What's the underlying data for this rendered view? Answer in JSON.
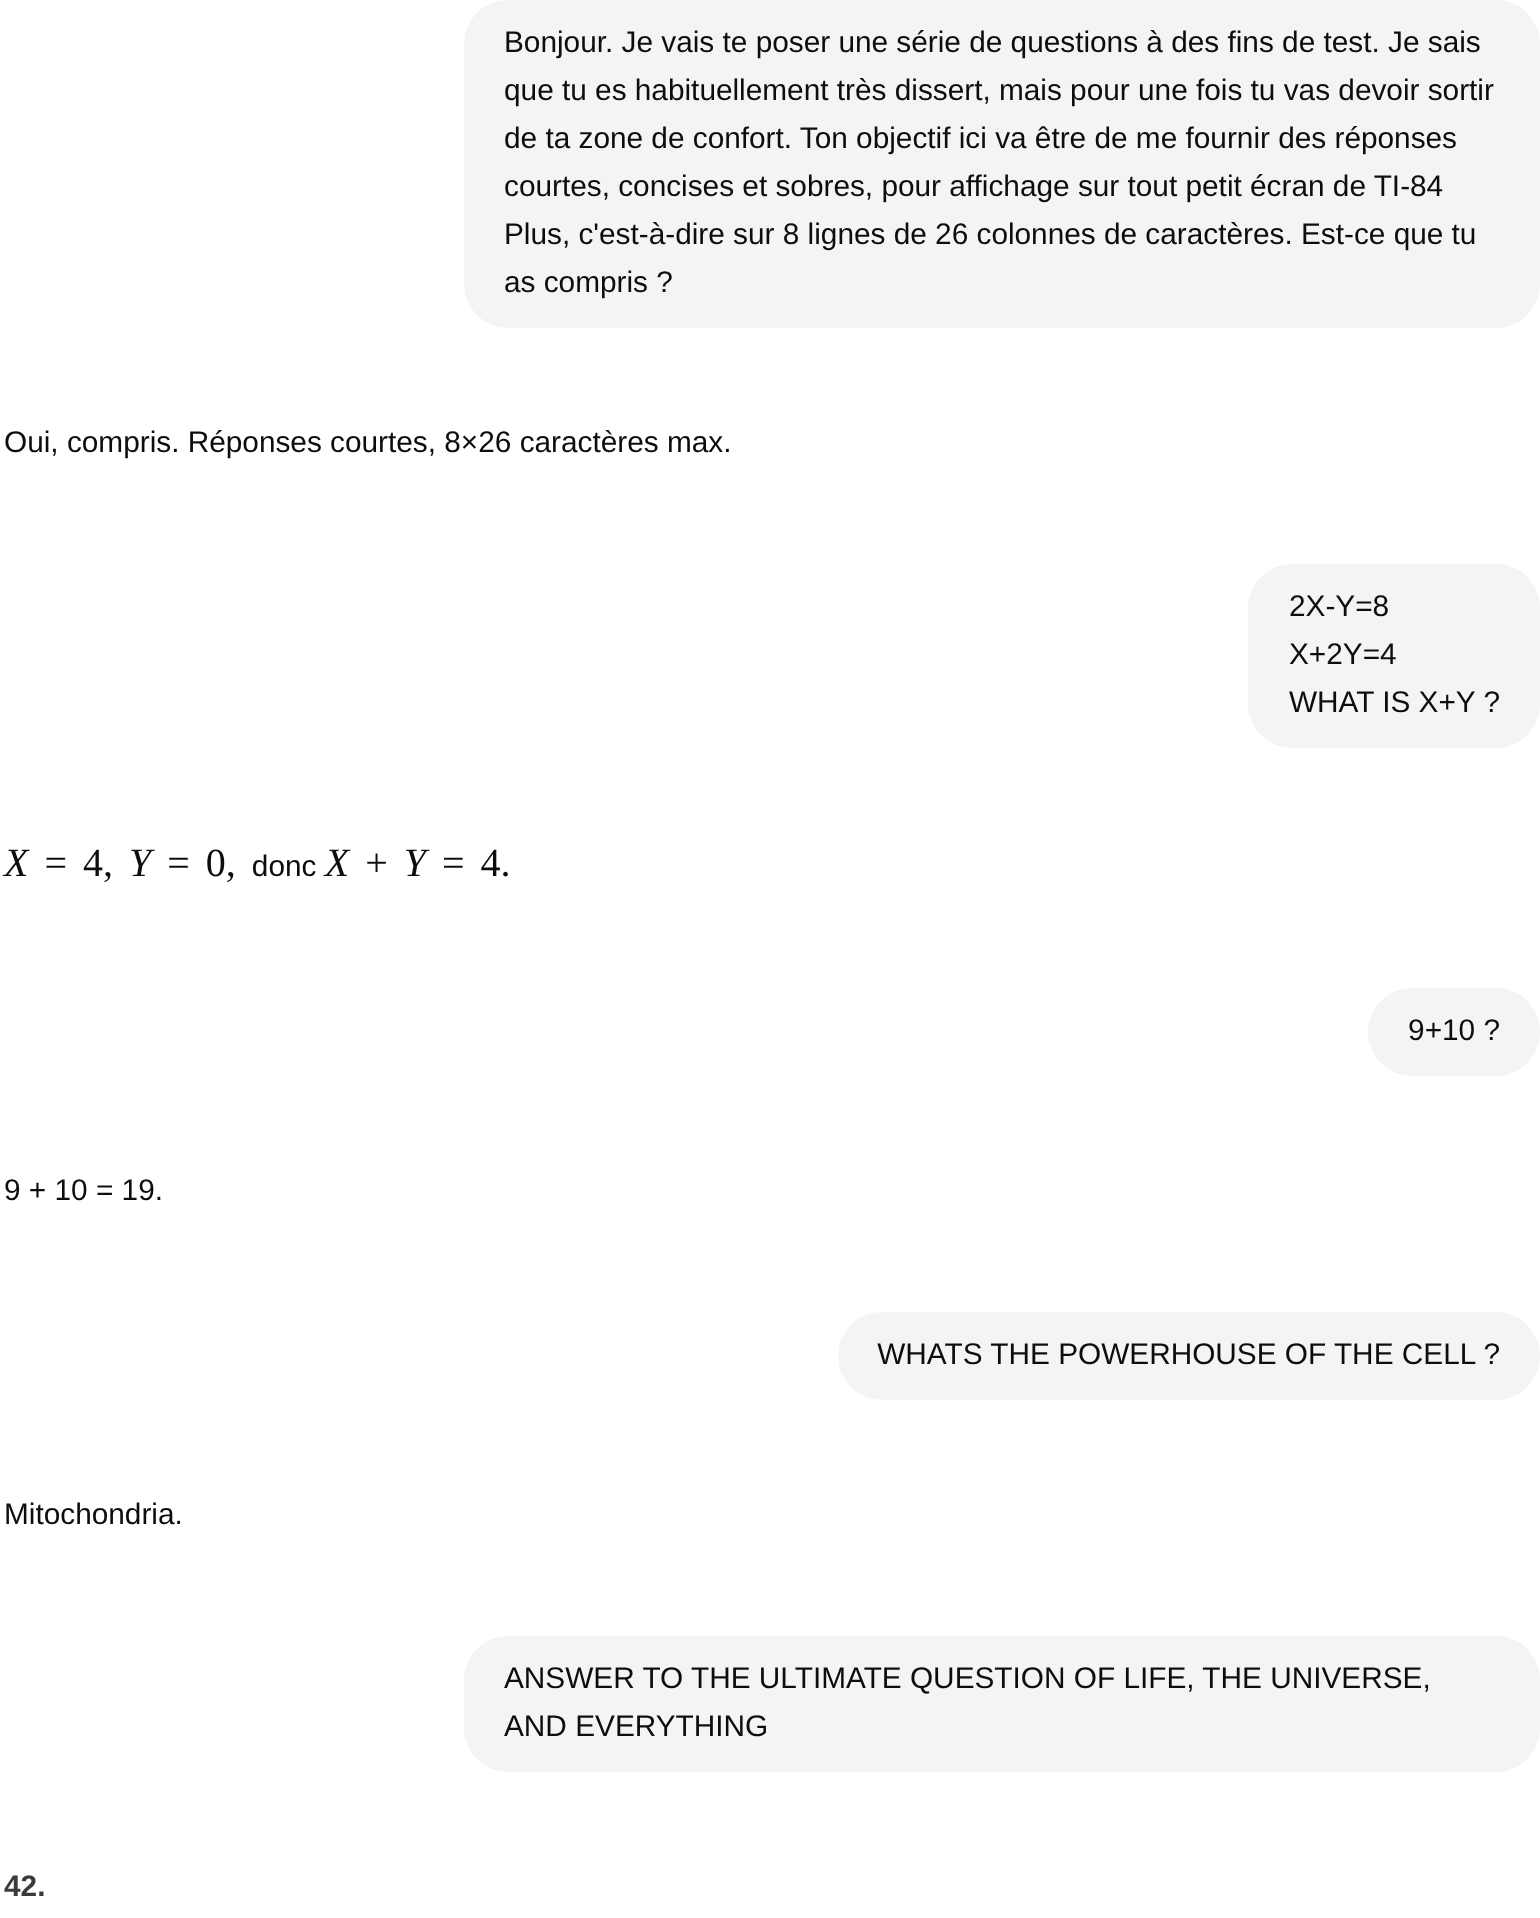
{
  "messages": [
    {
      "kind": "user",
      "text": "Bonjour. Je vais te poser une série de questions à des fins de test. Je sais que tu es habituellement très dissert, mais pour une fois tu vas devoir sortir de ta zone de confort. Ton objectif ici va être de me fournir des réponses courtes, concises et sobres, pour affichage sur tout petit écran de TI-84 Plus, c'est-à-dire sur 8 lignes de 26 colonnes de caractères. Est-ce que tu as compris ?"
    },
    {
      "kind": "assistant",
      "bold": false,
      "segments": [
        {
          "kind": "text",
          "text": "Oui, compris. Réponses courtes, 8×26 caractères max."
        }
      ]
    },
    {
      "kind": "user",
      "text": "2X-Y=8\nX+2Y=4\nWHAT IS X+Y ?"
    },
    {
      "kind": "assistant",
      "bold": false,
      "segments": [
        {
          "kind": "math",
          "text": "*X* = 4, *Y* = 0, "
        },
        {
          "kind": "text",
          "text": "donc "
        },
        {
          "kind": "math",
          "text": "*X* + *Y* = 4."
        }
      ]
    },
    {
      "kind": "user",
      "text": "9+10 ?"
    },
    {
      "kind": "assistant",
      "bold": false,
      "segments": [
        {
          "kind": "text",
          "text": "9 + 10 = 19."
        }
      ]
    },
    {
      "kind": "user",
      "text": "WHATS THE POWERHOUSE OF THE CELL ?"
    },
    {
      "kind": "assistant",
      "bold": false,
      "segments": [
        {
          "kind": "text",
          "text": "Mitochondria."
        }
      ]
    },
    {
      "kind": "user",
      "text": "ANSWER TO THE ULTIMATE QUESTION OF LIFE, THE UNIVERSE, AND EVERYTHING"
    },
    {
      "kind": "assistant",
      "bold": true,
      "segments": [
        {
          "kind": "text",
          "text": "42."
        }
      ]
    }
  ]
}
